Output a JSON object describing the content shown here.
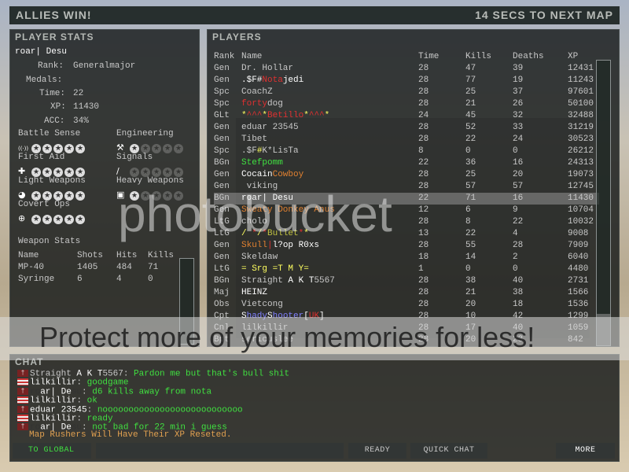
{
  "header": {
    "result": "ALLIES WIN!",
    "countdown": "14 SECS TO NEXT MAP"
  },
  "player_stats": {
    "title": "PLAYER STATS",
    "name": "roar| Desu",
    "rank_label": "Rank:",
    "rank": "Generalmajor",
    "medals_label": "Medals:",
    "time_label": "Time:",
    "time": "22",
    "xp_label": "XP:",
    "xp": "11430",
    "acc_label": "ACC:",
    "acc": "34%",
    "skills": [
      {
        "name": "Battle Sense",
        "icon": "radio-waves-icon",
        "level": 0
      },
      {
        "name": "Engineering",
        "icon": "wrench-icon",
        "level": 1
      },
      {
        "name": "First Aid",
        "icon": "cross-icon",
        "level": 0
      },
      {
        "name": "Signals",
        "icon": "flare-icon",
        "level": 0
      },
      {
        "name": "Light Weapons",
        "icon": "pistol-icon",
        "level": 0
      },
      {
        "name": "Heavy Weapons",
        "icon": "mg-icon",
        "level": 1
      },
      {
        "name": "Covert Ops",
        "icon": "crosshair-icon",
        "level": 0
      }
    ],
    "weapon_stats": {
      "title": "Weapon Stats",
      "columns": [
        "Name",
        "Shots",
        "Hits",
        "Kills"
      ],
      "rows": [
        [
          "MP-40",
          "1405",
          "484",
          "71"
        ],
        [
          "Syringe",
          "6",
          "4",
          "0"
        ]
      ]
    }
  },
  "players": {
    "title": "PLAYERS",
    "columns": [
      "Rank",
      "Name",
      "Time",
      "Kills",
      "Deaths",
      "XP"
    ],
    "highlight_index": 11,
    "rows": [
      {
        "rank": "Gen",
        "name": [
          [
            "Dr. Hollar",
            "#c8c8c8"
          ]
        ],
        "time": "28",
        "kills": "47",
        "deaths": "39",
        "xp": "12431"
      },
      {
        "rank": "Gen",
        "name": [
          [
            ".$F#",
            "#ffffff"
          ],
          [
            "Nota",
            "#e03030"
          ],
          [
            "jedi",
            "#ffffff"
          ]
        ],
        "time": "28",
        "kills": "77",
        "deaths": "19",
        "xp": "11243"
      },
      {
        "rank": "Spc",
        "name": [
          [
            "CoachZ",
            "#c8c8c8"
          ]
        ],
        "time": "28",
        "kills": "25",
        "deaths": "37",
        "xp": "97601"
      },
      {
        "rank": "Spc",
        "name": [
          [
            "forty",
            "#e03030"
          ],
          [
            "dog",
            "#c8c8c8"
          ]
        ],
        "time": "28",
        "kills": "21",
        "deaths": "26",
        "xp": "50100"
      },
      {
        "rank": "GLt",
        "name": [
          [
            "*",
            "#ffff60"
          ],
          [
            "^^^",
            "#e03030"
          ],
          [
            "*",
            "#ffff60"
          ],
          [
            "Betillo",
            "#e03030"
          ],
          [
            "*",
            "#ffff60"
          ],
          [
            "^^^",
            "#e03030"
          ],
          [
            "*",
            "#ffff60"
          ]
        ],
        "time": "24",
        "kills": "45",
        "deaths": "32",
        "xp": "32488"
      },
      {
        "rank": "Gen",
        "name": [
          [
            "eduar 23545",
            "#c8c8c8"
          ]
        ],
        "time": "28",
        "kills": "52",
        "deaths": "33",
        "xp": "31219"
      },
      {
        "rank": "Gen",
        "name": [
          [
            "Tibet",
            "#c8c8c8"
          ]
        ],
        "time": "28",
        "kills": "22",
        "deaths": "24",
        "xp": "30523"
      },
      {
        "rank": "Spc",
        "name": [
          [
            ".$F",
            "#c8c8c8"
          ],
          [
            "#",
            "#ffff60"
          ],
          [
            "K*LisTa",
            "#c8c8c8"
          ]
        ],
        "time": "8",
        "kills": "0",
        "deaths": "0",
        "xp": "26212"
      },
      {
        "rank": "BGn",
        "name": [
          [
            "Stefpomm",
            "#40e040"
          ]
        ],
        "time": "22",
        "kills": "36",
        "deaths": "16",
        "xp": "24313"
      },
      {
        "rank": "Gen",
        "name": [
          [
            "Cocain",
            "#ffffff"
          ],
          [
            "Cowboy",
            "#e08030"
          ]
        ],
        "time": "28",
        "kills": "25",
        "deaths": "20",
        "xp": "19073"
      },
      {
        "rank": "Gen",
        "name": [
          [
            " viking",
            "#c8c8c8"
          ]
        ],
        "time": "28",
        "kills": "57",
        "deaths": "57",
        "xp": "12745"
      },
      {
        "rank": "BGn",
        "name": [
          [
            "roar| Desu",
            "#ffffff"
          ]
        ],
        "time": "22",
        "kills": "71",
        "deaths": "16",
        "xp": "11430"
      },
      {
        "rank": "Gen",
        "name": [
          [
            "Sweaty Donkey Anus",
            "#e08030"
          ]
        ],
        "time": "12",
        "kills": "6",
        "deaths": "9",
        "xp": "10704"
      },
      {
        "rank": "LtG",
        "name": [
          [
            "cholo",
            "#c8c8c8"
          ]
        ],
        "time": "28",
        "kills": "8",
        "deaths": "22",
        "xp": "10032"
      },
      {
        "rank": "LtG",
        "name": [
          [
            "/ ",
            "#ffff60"
          ],
          [
            "*",
            "#e03030"
          ],
          [
            "/",
            "#ffff60"
          ],
          [
            "*",
            "#e03030"
          ],
          [
            "Bullet",
            "#c0c040"
          ],
          [
            "*",
            "#e03030"
          ],
          [
            "*",
            "#ffff60"
          ]
        ],
        "time": "13",
        "kills": "22",
        "deaths": "4",
        "xp": "9008"
      },
      {
        "rank": "Gen",
        "name": [
          [
            "Skull",
            "#e08030"
          ],
          [
            "|",
            "#e03030"
          ],
          [
            "l?op R0xs",
            "#ffffff"
          ]
        ],
        "time": "28",
        "kills": "55",
        "deaths": "28",
        "xp": "7909"
      },
      {
        "rank": "Gen",
        "name": [
          [
            "Skeldaw",
            "#c8c8c8"
          ]
        ],
        "time": "18",
        "kills": "14",
        "deaths": "2",
        "xp": "6040"
      },
      {
        "rank": "LtG",
        "name": [
          [
            "= Srg =T M Y=",
            "#ffff60"
          ]
        ],
        "time": "1",
        "kills": "0",
        "deaths": "0",
        "xp": "4480"
      },
      {
        "rank": "BGn",
        "name": [
          [
            "Straight ",
            "#c8c8c8"
          ],
          [
            "A K T",
            "#ffffff"
          ],
          [
            "5567",
            "#c8c8c8"
          ]
        ],
        "time": "28",
        "kills": "38",
        "deaths": "40",
        "xp": "2731"
      },
      {
        "rank": "Maj",
        "name": [
          [
            "HEINZ",
            "#ffffff"
          ]
        ],
        "time": "28",
        "kills": "21",
        "deaths": "38",
        "xp": "1566"
      },
      {
        "rank": "Obs",
        "name": [
          [
            "Vietcong",
            "#c8c8c8"
          ]
        ],
        "time": "28",
        "kills": "20",
        "deaths": "18",
        "xp": "1536"
      },
      {
        "rank": "Cpt",
        "name": [
          [
            "S",
            "#ffffff"
          ],
          [
            "hady",
            "#8080ff"
          ],
          [
            "S",
            "#ffffff"
          ],
          [
            "hooter",
            "#8080ff"
          ],
          [
            "[",
            "#ffffff"
          ],
          [
            "UK",
            "#e03030"
          ],
          [
            "]",
            "#ffffff"
          ]
        ],
        "time": "28",
        "kills": "10",
        "deaths": "42",
        "xp": "1299"
      },
      {
        "rank": "Cnl",
        "name": [
          [
            "lilkillir",
            "#c8c8c8"
          ]
        ],
        "time": "28",
        "kills": "17",
        "deaths": "40",
        "xp": "1059"
      },
      {
        "rank": "Bpt",
        "name": [
          [
            "sericuslee",
            "#c8c8c8"
          ]
        ],
        "time": "28",
        "kills": "20",
        "deaths": "23",
        "xp": "842"
      }
    ]
  },
  "chat": {
    "title": "CHAT",
    "messages": [
      {
        "team": "axis",
        "name": [
          [
            "Straight ",
            "#c8c8c8"
          ],
          [
            "A K T",
            "#ffffff"
          ],
          [
            "5567",
            "#c8c8c8"
          ]
        ],
        "text": "Pardon me but that's bull shit"
      },
      {
        "team": "allies",
        "name": [
          [
            "lilkillir",
            "#ffffff"
          ]
        ],
        "text": "goodgame"
      },
      {
        "team": "axis",
        "name": [
          [
            "ro",
            "#333333"
          ],
          [
            "ar| De",
            "#ffffff"
          ],
          [
            "su",
            "#333333"
          ]
        ],
        "text": "d6 kills away from nota"
      },
      {
        "team": "allies",
        "name": [
          [
            "lilkillir",
            "#ffffff"
          ]
        ],
        "text": "ok"
      },
      {
        "team": "axis",
        "name": [
          [
            "eduar 23545",
            "#ffffff"
          ]
        ],
        "text": "nooooooooooooooooooooooooooo"
      },
      {
        "team": "allies",
        "name": [
          [
            "lilkillir",
            "#ffffff"
          ]
        ],
        "text": "ready"
      },
      {
        "team": "axis",
        "name": [
          [
            "ro",
            "#333333"
          ],
          [
            "ar| De",
            "#ffffff"
          ],
          [
            "su",
            "#333333"
          ]
        ],
        "text": "not bad for 22 min i guess"
      }
    ],
    "server_message": "Map Rushers Will Have Their XP Reseted.",
    "chat_text_color": "#40e040",
    "to_global_label": "TO GLOBAL",
    "input_value": "",
    "ready_label": "READY",
    "quick_chat_label": "QUICK CHAT",
    "more_label": "MORE"
  },
  "watermark": {
    "logo": "photobucket",
    "banner": "Protect more of your memories for less!"
  }
}
